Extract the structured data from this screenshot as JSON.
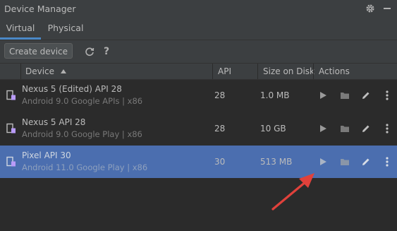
{
  "window": {
    "title": "Device Manager"
  },
  "icons": {
    "settings": "gear-icon",
    "minimize": "minimize-icon",
    "refresh": "refresh-icon",
    "help": "question-icon"
  },
  "tabs": [
    {
      "label": "Virtual",
      "active": true
    },
    {
      "label": "Physical",
      "active": false
    }
  ],
  "toolbar": {
    "create_label": "Create device",
    "help_glyph": "?"
  },
  "table": {
    "headers": {
      "device": "Device",
      "api": "API",
      "size": "Size on Disk",
      "actions": "Actions"
    },
    "sort": {
      "column": "Device",
      "direction": "ascending"
    },
    "rows": [
      {
        "name": "Nexus 5 (Edited) API 28",
        "subtitle": "Android 9.0 Google APIs | x86",
        "api": "28",
        "size": "1.0 MB",
        "selected": false
      },
      {
        "name": "Nexus 5 API 28",
        "subtitle": "Android 9.0 Google Play | x86",
        "api": "28",
        "size": "10 GB",
        "selected": false
      },
      {
        "name": "Pixel API 30",
        "subtitle": "Android 11.0 Google Play | x86",
        "api": "30",
        "size": "513 MB",
        "selected": true
      }
    ]
  },
  "colors": {
    "accent": "#4a88c7",
    "selection": "#4b6eaf",
    "annotation_arrow": "#e0413b",
    "device_icon": "#b99bf8"
  }
}
